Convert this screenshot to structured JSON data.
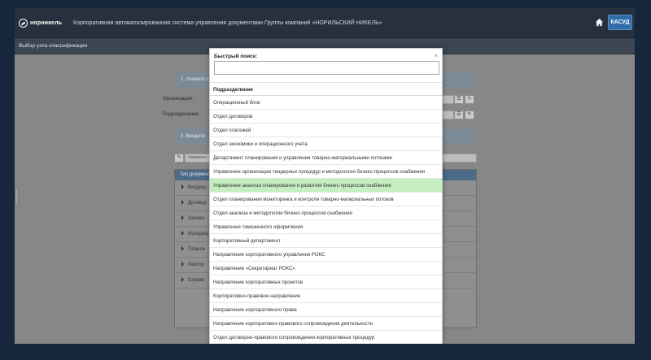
{
  "header": {
    "logo_text": "норникель",
    "app_title": "Корпоративная автоматизированная система управления документами Группы компаний «НОРИЛЬСКИЙ НИКЕЛЬ»",
    "kasud_label": "КАСУД"
  },
  "subbar": {
    "title": "Выбор узла классификации"
  },
  "background": {
    "step1": "1. Укажите с",
    "org_label": "Организация:",
    "dept_label": "Подразделение:",
    "step2": "2. Введите",
    "search_placeholder": "Наимено",
    "tree_header": "Тип документ",
    "tree_rows": [
      "Входящ",
      "Договор",
      "Заключ",
      "Исходящ",
      "Планов",
      "Распор",
      "Справк"
    ]
  },
  "modal": {
    "title": "Быстрый поиск:",
    "search_value": "",
    "close_symbol": "×",
    "list_header": "Подразделение",
    "selected_index": 6,
    "items": [
      "Операционный блок",
      "Отдел договоров",
      "Отдел платежей",
      "Отдел экономики и операционного учета",
      "Департамент планирования и управления товарно-материальными потоками",
      "Управление организации тендерных процедур и методологии бизнес-процессов снабжения",
      "Управление анализа планирования и развития бизнес-процессов снабжения",
      "Отдел планирования мониторинга и контроля товарно-материальных потоков",
      "Отдел анализа и методологии бизнес-процессов снабжения",
      "Управление таможенного оформления",
      "Корпоративный департамент",
      "Направление корпоративного управления РОКС",
      "Направление «Секретариат РОКС»",
      "Направление корпоративных проектов",
      "Корпоративно-правовое направление",
      "Направление корпоративного права",
      "Направление корпоративно-правового сопровождения деятельности",
      "Отдел договорно-правового сопровождения корпоративных процедур"
    ]
  },
  "colors": {
    "page_bg": "#16263d",
    "topbar_bg": "#26313d",
    "kasud_btn": "#2f6ca8",
    "selected_row": "#c5eec0"
  }
}
